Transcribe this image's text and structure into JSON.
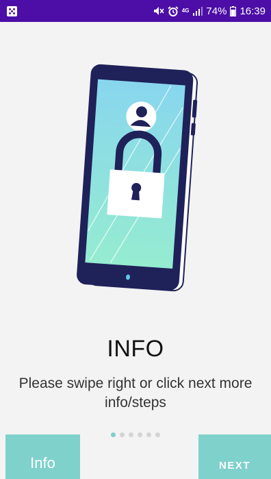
{
  "status_bar": {
    "network_type": "4G",
    "battery": "74%",
    "time": "16:39",
    "icons": [
      "notification-icon",
      "mute-icon",
      "alarm-icon",
      "signal-icon",
      "battery-icon"
    ],
    "background": "#4c0ea6"
  },
  "onboarding": {
    "title": "INFO",
    "description": "Please swipe right or click next more info/steps",
    "illustration": "phone-lock-icon",
    "page_indicator": {
      "total": 6,
      "current": 1
    }
  },
  "buttons": {
    "info_label": "Info",
    "next_label": "NEXT"
  },
  "colors": {
    "accent": "#7fd1cc",
    "status_bar": "#4c0ea6",
    "phone_frame": "#1f2159"
  }
}
